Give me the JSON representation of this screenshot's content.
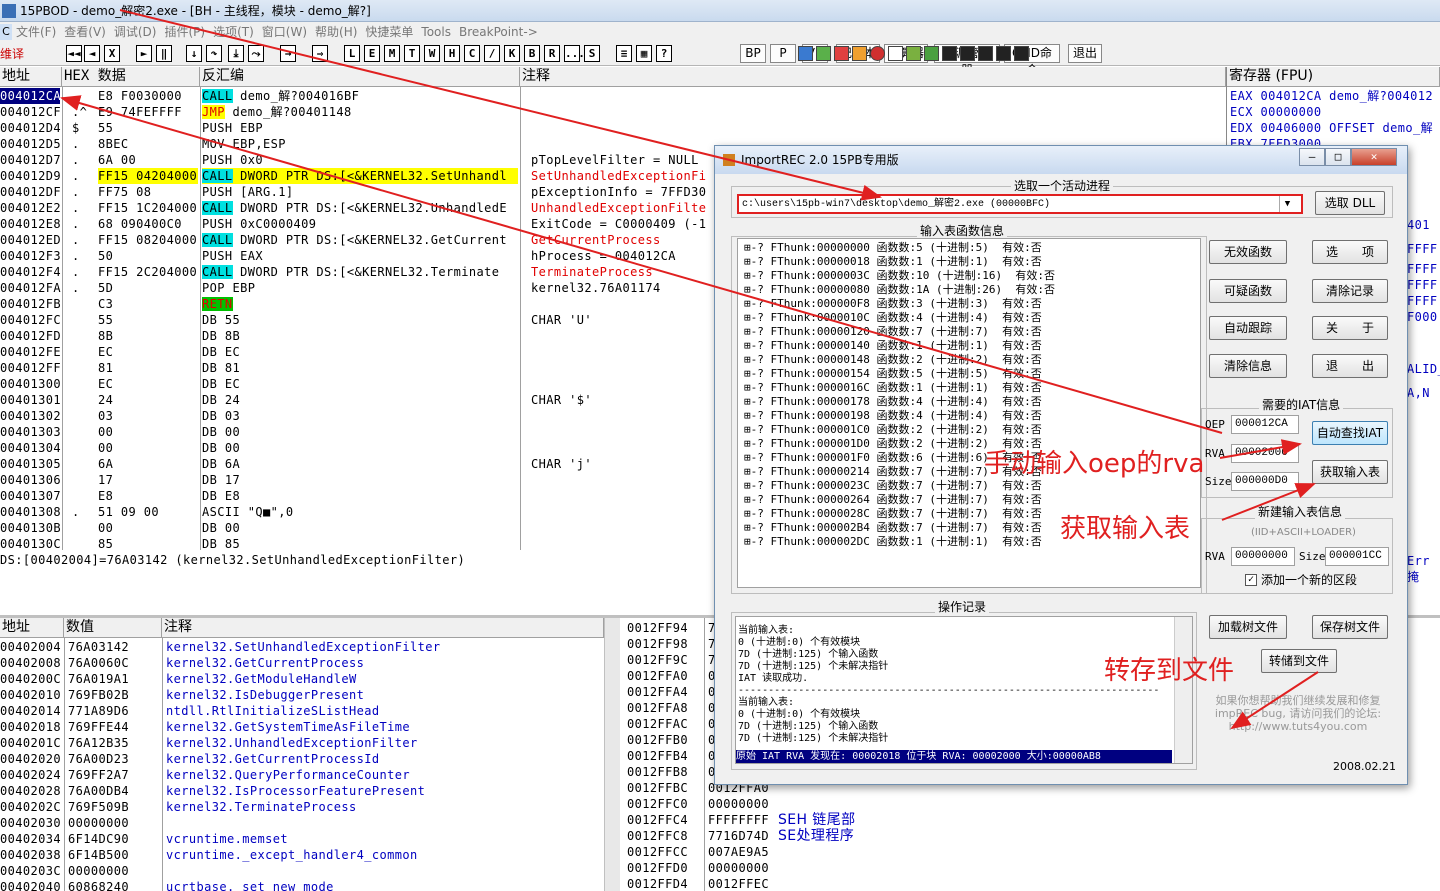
{
  "window": {
    "title": "15PBOD - demo_解密2.exe - [BH - 主线程，模块 - demo_解?]"
  },
  "menu": [
    "文件(F)",
    "查看(V)",
    "调试(D)",
    "插件(P)",
    "选项(T)",
    "窗口(W)",
    "帮助(H)",
    "快捷菜单",
    "Tools",
    "BreakPoint->"
  ],
  "menu_tag": "C",
  "toolbar_left": "维译",
  "letter_buttons": [
    "L",
    "E",
    "M",
    "T",
    "W",
    "H",
    "C",
    "/",
    "K",
    "B",
    "R",
    "...",
    "S"
  ],
  "plugin_buttons": [
    "BP",
    "P",
    "VB",
    "记事本",
    "计算器",
    "资源管理器",
    "CMD命令",
    "退出"
  ],
  "disasm": {
    "headers": {
      "addr": "地址",
      "hex": "HEX 数据",
      "asm": "反汇编",
      "comment": "注释"
    },
    "rows": [
      {
        "a": "004012CA",
        "m": ".",
        "h": "E8 F0030000",
        "i": "CALL",
        "o": " demo_解?004016BF",
        "c": "",
        "k": "call",
        "sel": true
      },
      {
        "a": "004012CF",
        "m": ".^",
        "h": "E9 74FEFFFF",
        "i": "JMP",
        "o": " demo_解?00401148",
        "c": "",
        "k": "jmp"
      },
      {
        "a": "004012D4",
        "m": "$",
        "h": "55",
        "i": "PUSH EBP",
        "o": "",
        "c": "",
        "k": ""
      },
      {
        "a": "004012D5",
        "m": ".",
        "h": "8BEC",
        "i": "MOV EBP,ESP",
        "o": "",
        "c": "",
        "k": ""
      },
      {
        "a": "004012D7",
        "m": ".",
        "h": "6A 00",
        "i": "PUSH 0x0",
        "o": "",
        "c": "pTopLevelFilter = NULL",
        "k": ""
      },
      {
        "a": "004012D9",
        "m": ".",
        "h": "FF15 04204000",
        "i": "CALL",
        "o": " DWORD PTR DS:[<&KERNEL32.SetUnhandl",
        "c": "SetUnhandledExceptionFi",
        "k": "call",
        "hl": true,
        "cred": true
      },
      {
        "a": "004012DF",
        "m": ".",
        "h": "FF75 08",
        "i": "PUSH [ARG.1]",
        "o": "",
        "c": "pExceptionInfo = 7FFD30",
        "k": ""
      },
      {
        "a": "004012E2",
        "m": ".",
        "h": "FF15 1C204000",
        "i": "CALL",
        "o": " DWORD PTR DS:[<&KERNEL32.UnhandledE",
        "c": "UnhandledExceptionFilte",
        "k": "call",
        "cred": true
      },
      {
        "a": "004012E8",
        "m": ".",
        "h": "68 090400C0",
        "i": "PUSH 0xC0000409",
        "o": "",
        "c": "ExitCode = C0000409 (-1",
        "k": ""
      },
      {
        "a": "004012ED",
        "m": ".",
        "h": "FF15 08204000",
        "i": "CALL",
        "o": " DWORD PTR DS:[<&KERNEL32.GetCurrent",
        "c": "GetCurrentProcess",
        "k": "call",
        "cred": true
      },
      {
        "a": "004012F3",
        "m": ".",
        "h": "50",
        "i": "PUSH EAX",
        "o": "",
        "c": "hProcess = 004012CA",
        "k": ""
      },
      {
        "a": "004012F4",
        "m": ".",
        "h": "FF15 2C204000",
        "i": "CALL",
        "o": " DWORD PTR DS:[<&KERNEL32.Terminate",
        "c": "TerminateProcess",
        "k": "call",
        "cred": true
      },
      {
        "a": "004012FA",
        "m": ".",
        "h": "5D",
        "i": "POP EBP",
        "o": "",
        "c": "kernel32.76A01174",
        "k": ""
      },
      {
        "a": "004012FB",
        "m": "",
        "h": "C3",
        "i": "RETN",
        "o": "",
        "c": "",
        "k": "ret"
      },
      {
        "a": "004012FC",
        "m": "",
        "h": "55",
        "i": "DB 55",
        "o": "",
        "c": "CHAR 'U'",
        "k": ""
      },
      {
        "a": "004012FD",
        "m": "",
        "h": "8B",
        "i": "DB 8B",
        "o": "",
        "c": "",
        "k": ""
      },
      {
        "a": "004012FE",
        "m": "",
        "h": "EC",
        "i": "DB EC",
        "o": "",
        "c": "",
        "k": ""
      },
      {
        "a": "004012FF",
        "m": "",
        "h": "81",
        "i": "DB 81",
        "o": "",
        "c": "",
        "k": ""
      },
      {
        "a": "00401300",
        "m": "",
        "h": "EC",
        "i": "DB EC",
        "o": "",
        "c": "",
        "k": ""
      },
      {
        "a": "00401301",
        "m": "",
        "h": "24",
        "i": "DB 24",
        "o": "",
        "c": "CHAR '$'",
        "k": ""
      },
      {
        "a": "00401302",
        "m": "",
        "h": "03",
        "i": "DB 03",
        "o": "",
        "c": "",
        "k": ""
      },
      {
        "a": "00401303",
        "m": "",
        "h": "00",
        "i": "DB 00",
        "o": "",
        "c": "",
        "k": ""
      },
      {
        "a": "00401304",
        "m": "",
        "h": "00",
        "i": "DB 00",
        "o": "",
        "c": "",
        "k": ""
      },
      {
        "a": "00401305",
        "m": "",
        "h": "6A",
        "i": "DB 6A",
        "o": "",
        "c": "CHAR 'j'",
        "k": ""
      },
      {
        "a": "00401306",
        "m": "",
        "h": "17",
        "i": "DB 17",
        "o": "",
        "c": "",
        "k": ""
      },
      {
        "a": "00401307",
        "m": "",
        "h": "E8",
        "i": "DB E8",
        "o": "",
        "c": "",
        "k": ""
      },
      {
        "a": "00401308",
        "m": ".",
        "h": "51 09 00",
        "i": "ASCII \"Q■\",0",
        "o": "",
        "c": "",
        "k": ""
      },
      {
        "a": "0040130B",
        "m": "",
        "h": "00",
        "i": "DB 00",
        "o": "",
        "c": "",
        "k": ""
      },
      {
        "a": "0040130C",
        "m": "",
        "h": "85",
        "i": "DB 85",
        "o": "",
        "c": "",
        "k": ""
      }
    ],
    "info": "DS:[00402004]=76A03142 (kernel32.SetUnhandledExceptionFilter)"
  },
  "registers": {
    "header": "寄存器 (FPU)",
    "rows": [
      "EAX 004012CA demo_解?004012",
      "ECX 00000000",
      "EDX 00406000 OFFSET demo_解",
      "EBX 7FFD3000"
    ],
    "side": [
      "401",
      "FFFF",
      "FFFF",
      "FFFF",
      "FFFF",
      "F000",
      "ALID_",
      "A,N",
      "Err",
      "掩"
    ]
  },
  "dump": {
    "headers": {
      "addr": "地址",
      "val": "数值",
      "comment": "注释"
    },
    "rows": [
      {
        "a": "00402004",
        "v": "76A03142",
        "c": "kernel32.SetUnhandledExceptionFilter"
      },
      {
        "a": "00402008",
        "v": "76A0060C",
        "c": "kernel32.GetCurrentProcess"
      },
      {
        "a": "0040200C",
        "v": "76A019A1",
        "c": "kernel32.GetModuleHandleW"
      },
      {
        "a": "00402010",
        "v": "769FB02B",
        "c": "kernel32.IsDebuggerPresent"
      },
      {
        "a": "00402014",
        "v": "771A89D6",
        "c": "ntdll.RtlInitializeSListHead"
      },
      {
        "a": "00402018",
        "v": "769FFE44",
        "c": "kernel32.GetSystemTimeAsFileTime"
      },
      {
        "a": "0040201C",
        "v": "76A12B35",
        "c": "kernel32.UnhandledExceptionFilter"
      },
      {
        "a": "00402020",
        "v": "76A00D23",
        "c": "kernel32.GetCurrentProcessId"
      },
      {
        "a": "00402024",
        "v": "769FF2A7",
        "c": "kernel32.QueryPerformanceCounter"
      },
      {
        "a": "00402028",
        "v": "76A00DB4",
        "c": "kernel32.IsProcessorFeaturePresent"
      },
      {
        "a": "0040202C",
        "v": "769F509B",
        "c": "kernel32.TerminateProcess"
      },
      {
        "a": "00402030",
        "v": "00000000",
        "c": ""
      },
      {
        "a": "00402034",
        "v": "6F14DC90",
        "c": "vcruntime.memset"
      },
      {
        "a": "00402038",
        "v": "6F14B500",
        "c": "vcruntime._except_handler4_common"
      },
      {
        "a": "0040203C",
        "v": "00000000",
        "c": ""
      },
      {
        "a": "00402040",
        "v": "60868240",
        "c": "ucrtbase._set_new_mode"
      }
    ]
  },
  "stack": {
    "rows": [
      {
        "a": "0012FF94",
        "v": "7",
        "c": ""
      },
      {
        "a": "0012FF98",
        "v": "7",
        "c": ""
      },
      {
        "a": "0012FF9C",
        "v": "7",
        "c": ""
      },
      {
        "a": "0012FFA0",
        "v": "0",
        "c": ""
      },
      {
        "a": "0012FFA4",
        "v": "0",
        "c": ""
      },
      {
        "a": "0012FFA8",
        "v": "0",
        "c": ""
      },
      {
        "a": "0012FFAC",
        "v": "0",
        "c": ""
      },
      {
        "a": "0012FFB0",
        "v": "0",
        "c": ""
      },
      {
        "a": "0012FFB4",
        "v": "0",
        "c": ""
      },
      {
        "a": "0012FFB8",
        "v": "0",
        "c": ""
      },
      {
        "a": "0012FFBC",
        "v": "0012FFA0",
        "c": ""
      },
      {
        "a": "0012FFC0",
        "v": "00000000",
        "c": ""
      },
      {
        "a": "0012FFC4",
        "v": "FFFFFFFF",
        "c": "SEH 链尾部"
      },
      {
        "a": "0012FFC8",
        "v": "7716D74D",
        "c": "SE处理程序"
      },
      {
        "a": "0012FFCC",
        "v": "007AE9A5",
        "c": ""
      },
      {
        "a": "0012FFD0",
        "v": "00000000",
        "c": ""
      },
      {
        "a": "0012FFD4",
        "v": "0012FFEC",
        "c": ""
      }
    ]
  },
  "importrec": {
    "title": "ImportREC 2.0 15PB专用版",
    "process_group": "选取一个活动进程",
    "process": "c:\\users\\15pb-win7\\desktop\\demo_解密2.exe (00000BFC)",
    "pick_dll": "选取 DLL",
    "iat_group": "输入表函数信息",
    "thunks": [
      {
        "t": "00000000",
        "n": "5",
        "d": ":5"
      },
      {
        "t": "00000018",
        "n": "1",
        "d": ":1"
      },
      {
        "t": "0000003C",
        "n": "10",
        "d": ":16"
      },
      {
        "t": "00000080",
        "n": "1A",
        "d": ":26"
      },
      {
        "t": "000000F8",
        "n": "3",
        "d": ":3"
      },
      {
        "t": "0000010C",
        "n": "4",
        "d": ":4"
      },
      {
        "t": "00000120",
        "n": "7",
        "d": ":7"
      },
      {
        "t": "00000140",
        "n": "1",
        "d": ":1"
      },
      {
        "t": "00000148",
        "n": "2",
        "d": ":2"
      },
      {
        "t": "00000154",
        "n": "5",
        "d": ":5"
      },
      {
        "t": "0000016C",
        "n": "1",
        "d": ":1"
      },
      {
        "t": "00000178",
        "n": "4",
        "d": ":4"
      },
      {
        "t": "00000198",
        "n": "4",
        "d": ":4"
      },
      {
        "t": "000001C0",
        "n": "2",
        "d": ":2"
      },
      {
        "t": "000001D0",
        "n": "2",
        "d": ":2"
      },
      {
        "t": "000001F0",
        "n": "6",
        "d": ":6"
      },
      {
        "t": "00000214",
        "n": "7",
        "d": ":7"
      },
      {
        "t": "0000023C",
        "n": "7",
        "d": ":7"
      },
      {
        "t": "00000264",
        "n": "7",
        "d": ":7"
      },
      {
        "t": "0000028C",
        "n": "7",
        "d": ":7"
      },
      {
        "t": "000002B4",
        "n": "7",
        "d": ":7"
      },
      {
        "t": "000002DC",
        "n": "1",
        "d": ":1"
      }
    ],
    "thunk_prefix": "⊞-? FThunk:",
    "thunk_fn": "函数数:",
    "thunk_dec": "(十进制",
    "thunk_valid": "有效:否",
    "buttons": {
      "invalid": "无效函数",
      "options": "选　　项",
      "suspect": "可疑函数",
      "clear_log": "清除记录",
      "autotrace": "自动跟踪",
      "about": "关　　于",
      "clear_info": "清除信息",
      "exit": "退　　出",
      "auto_iat": "自动查找IAT",
      "get_imports": "获取输入表",
      "load_tree": "加载树文件",
      "save_tree": "保存树文件",
      "dump": "转储到文件"
    },
    "iat_info": {
      "group": "需要的IAT信息",
      "oep_label": "OEP",
      "oep": "000012CA",
      "rva_label": "RVA",
      "rva": "00002000",
      "size_label": "Size",
      "size": "000000D0"
    },
    "new_iat": {
      "group": "新建输入表信息",
      "sub": "(IID+ASCII+LOADER)",
      "rva_label": "RVA",
      "rva": "00000000",
      "size_label": "Size",
      "size": "000001CC",
      "check": "添加一个新的区段"
    },
    "log_group": "操作记录",
    "log": [
      "当前输入表:",
      "0 (十进制:0) 个有效模块",
      "7D (十进制:125) 个输入函数",
      "7D (十进制:125) 个未解决指针",
      "IAT 读取成功.",
      "----------------------------------------------------------------------",
      "当前输入表:",
      "0 (十进制:0) 个有效模块",
      "7D (十进制:125) 个输入函数",
      "7D (十进制:125) 个未解决指针"
    ],
    "log_sel": "原始 IAT RVA 发现在: 00002018 位于块 RVA: 00002000 大小:00000AB8",
    "footer": "如果你想帮助我们继续发展和修复 impREC bug, 请访问我们的论坛: http://www.tuts4you.com",
    "date": "2008.02.21"
  },
  "annotations": {
    "oep": "手动输入oep的rva",
    "imports": "获取输入表",
    "dump": "转存到文件"
  },
  "colors": {
    "selection": "#000080",
    "call": "#00e0e0",
    "highlight": "#ffff00",
    "arrow": "#e02020"
  }
}
